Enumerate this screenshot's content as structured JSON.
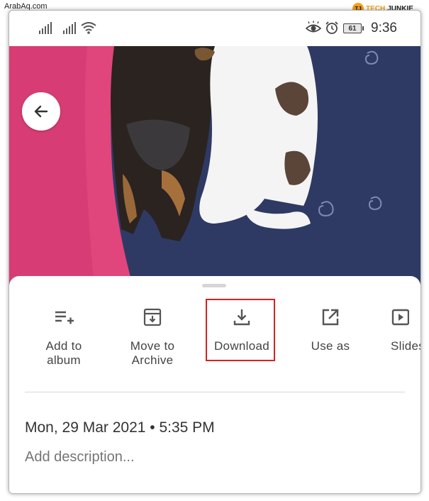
{
  "watermark": "ArabAq.com",
  "brand": {
    "logo_mark": "TJ",
    "name_part1": "TECH",
    "name_part2": "JUNKIE",
    "colors": {
      "accent": "#f0a21b",
      "dark": "#222222"
    }
  },
  "status_bar": {
    "battery_level": "61",
    "time": "9:36",
    "icons": [
      "signal-icon",
      "signal-icon",
      "wifi-icon",
      "eye-icon",
      "alarm-icon",
      "battery-icon"
    ]
  },
  "photo": {
    "back_icon": "arrow-left-icon",
    "colors": {
      "pink_blanket": "#e0457c",
      "blue_fabric": "#2e3a63",
      "puppy_white": "#f4f4f4",
      "puppy_dark": "#2a2320"
    }
  },
  "sheet": {
    "actions": [
      {
        "label": "Add to\nalbum",
        "icon": "playlist-add-icon"
      },
      {
        "label": "Move to\nArchive",
        "icon": "archive-icon"
      },
      {
        "label": "Download",
        "icon": "download-icon"
      },
      {
        "label": "Use as",
        "icon": "open-external-icon"
      },
      {
        "label": "Slidesh",
        "icon": "slideshow-icon"
      }
    ],
    "highlighted_action": "Download",
    "highlight_color": "#d32222",
    "datetime": "Mon, 29 Mar 2021  •  5:35 PM",
    "description_placeholder": "Add description..."
  }
}
